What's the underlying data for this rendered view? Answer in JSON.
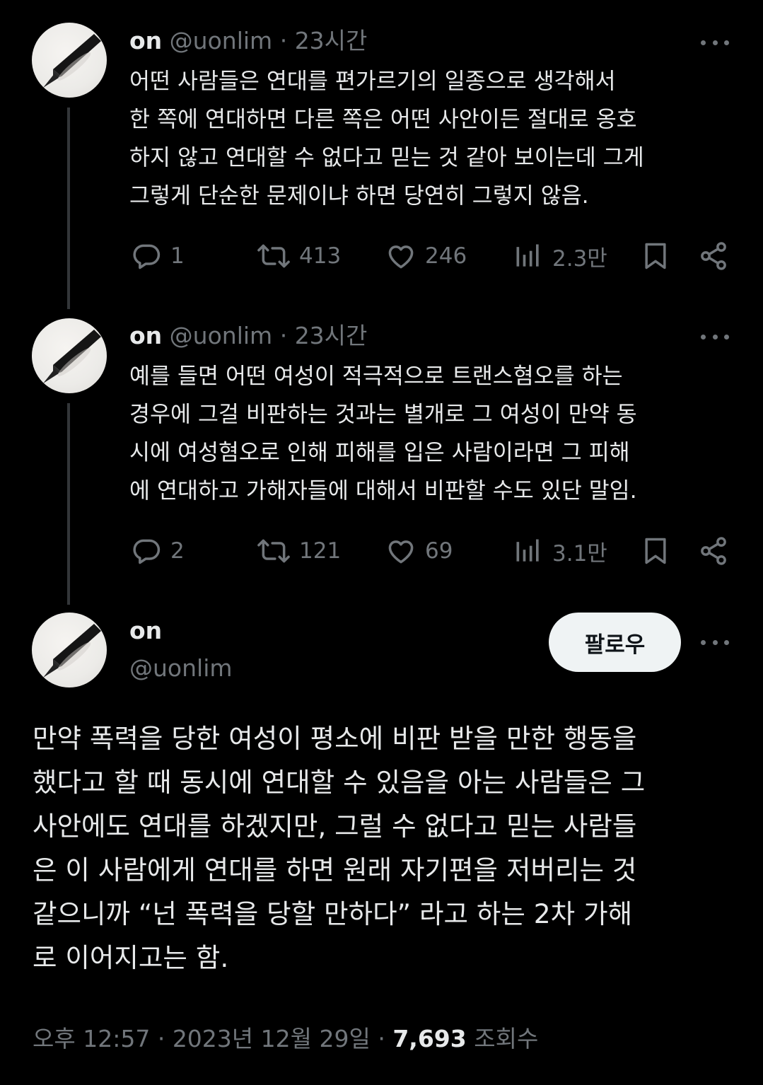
{
  "tweets": [
    {
      "name": "on",
      "handle": "@uonlim",
      "separator": "·",
      "time": "23시간",
      "text": "어떤 사람들은 연대를 편가르기의 일종으로 생각해서\n한 쪽에 연대하면 다른 쪽은 어떤 사안이든 절대로 옹호\n하지 않고 연대할 수 없다고 믿는 것 같아 보이는데 그게\n그렇게 단순한 문제이냐 하면 당연히 그렇지 않음.",
      "replies": "1",
      "retweets": "413",
      "likes": "246",
      "views": "2.3만"
    },
    {
      "name": "on",
      "handle": "@uonlim",
      "separator": "·",
      "time": "23시간",
      "text": "예를 들면 어떤 여성이 적극적으로 트랜스혐오를 하는\n경우에 그걸 비판하는 것과는 별개로 그 여성이 만약 동\n시에 여성혐오로 인해 피해를 입은 사람이라면 그 피해\n에 연대하고 가해자들에 대해서 비판할 수도 있단 말임.",
      "replies": "2",
      "retweets": "121",
      "likes": "69",
      "views": "3.1만"
    }
  ],
  "main_tweet": {
    "name": "on",
    "handle": "@uonlim",
    "follow_label": "팔로우",
    "text": "만약 폭력을 당한 여성이 평소에 비판 받을 만한 행동을\n했다고 할 때 동시에 연대할 수 있음을 아는 사람들은 그\n사안에도 연대를 하겠지만, 그럴 수 없다고 믿는 사람들\n은 이 사람에게 연대를 하면 원래 자기편을 저버리는 것\n같으니까 “넌 폭력을 당할 만하다” 라고 하는 2차 가해\n로 이어지고는 함.",
    "time": "오후 12:57",
    "separator": "·",
    "date": "2023년 12월 29일",
    "separator2": "·",
    "views_count": "7,693",
    "views_label": "조회수"
  },
  "icons": {
    "reply": "reply-icon",
    "retweet": "retweet-icon",
    "like": "heart-icon",
    "views": "analytics-icon",
    "bookmark": "bookmark-icon",
    "share": "share-icon",
    "more": "more-icon"
  },
  "colors": {
    "background": "#000000",
    "text": "#e7e9ea",
    "secondary": "#71767b",
    "follow_bg": "#eff3f4",
    "thread_line": "#333639"
  }
}
